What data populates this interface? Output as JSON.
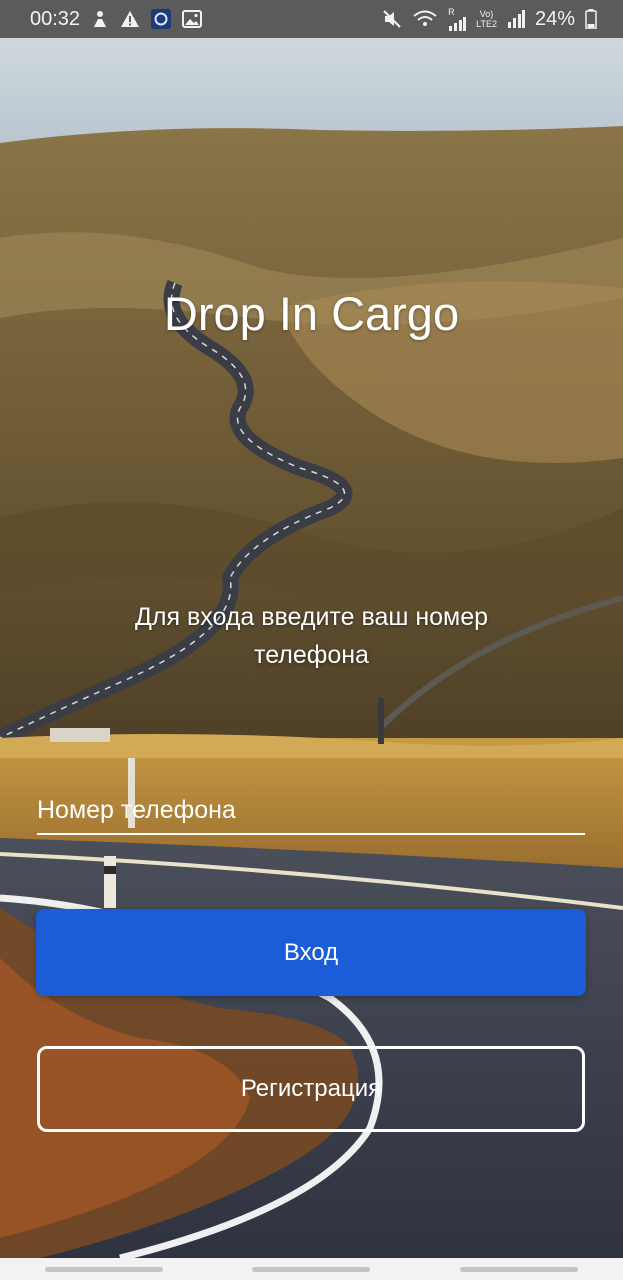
{
  "status_bar": {
    "time": "00:32",
    "battery": "24%",
    "left_icons": [
      "person-icon",
      "warning-icon",
      "app-badge-icon",
      "image-icon"
    ],
    "right_icons": [
      "mute-icon",
      "wifi-icon",
      "signal-icon",
      "volte-icon",
      "signal-icon",
      "battery-icon"
    ],
    "volte_top": "Vo)",
    "volte_bottom": "LTE2",
    "r_label": "R"
  },
  "app": {
    "title": "Drop In Cargo",
    "prompt": "Для входа введите ваш номер телефона"
  },
  "form": {
    "phone_placeholder": "Номер телефона",
    "phone_value": "",
    "login_label": "Вход",
    "register_label": "Регистрация"
  },
  "colors": {
    "primary": "#1a5dd6",
    "text": "#ffffff",
    "status_bar": "#5b5b5b",
    "nav_bar": "#f2f2f2"
  }
}
